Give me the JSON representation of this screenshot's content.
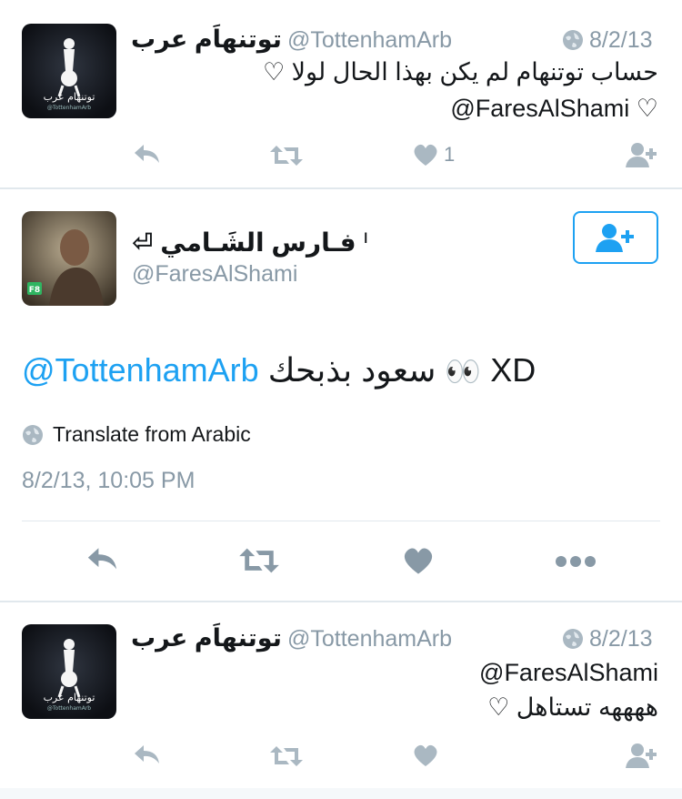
{
  "colors": {
    "accent": "#1da1f2",
    "muted": "#8899a6",
    "text": "#14171a",
    "divider": "#e1e8ed"
  },
  "reply1": {
    "name": "توتنهاَم عرب",
    "handle": "@TottenhamArb",
    "date": "8/2/13",
    "line1": "حساب توتنهام لم يكن بهذا الحال لولا ♡",
    "line2": "@FaresAlShami ♡",
    "like_count": "1",
    "avatar_text": "توتنهام عرب",
    "avatar_sub": "@TottenhamArb"
  },
  "main": {
    "name": "فـارس الشَـامي",
    "name_prefix": "⏎",
    "name_suffix": "ᑊ",
    "handle": "@FaresAlShami",
    "mention": "@TottenhamArb",
    "text_ar": "سعود بذبحك",
    "eyes": "👀",
    "text_tail": "XD",
    "translate_label": "Translate from Arabic",
    "timestamp": "8/2/13, 10:05 PM"
  },
  "reply2": {
    "name": "توتنهاَم عرب",
    "handle": "@TottenhamArb",
    "date": "8/2/13",
    "line1": "@FaresAlShami",
    "line2": "ههههه تستاهل ♡",
    "avatar_text": "توتنهام عرب",
    "avatar_sub": "@TottenhamArb"
  },
  "icons": {
    "reply": "reply-icon",
    "retweet": "retweet-icon",
    "like": "heart-icon",
    "follow": "follow-icon",
    "more": "more-icon",
    "globe": "globe-icon"
  }
}
